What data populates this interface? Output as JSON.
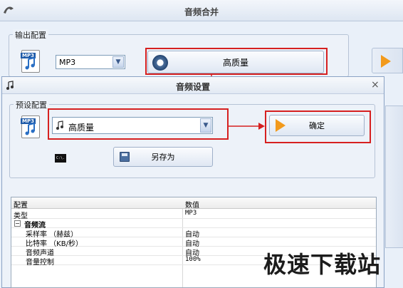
{
  "main": {
    "title": "音频合并",
    "output_group_label": "输出配置",
    "format_value": "MP3",
    "quality_button_label": "高质量"
  },
  "dialog": {
    "title": "音频设置",
    "close_glyph": "×",
    "preset_group_label": "预设配置",
    "preset_value": "高质量",
    "confirm_label": "确定",
    "save_as_label": "另存为",
    "cmd_glyph": "C:\\."
  },
  "icons": {
    "file_tag": "MP3"
  },
  "grid": {
    "headers": [
      "配置",
      "数值"
    ],
    "rows": [
      {
        "name": "类型",
        "value": "MP3"
      },
      {
        "name": "音频流",
        "value": ""
      },
      {
        "name": "采样率 （赫兹）",
        "value": "自动"
      },
      {
        "name": "比特率 （KB/秒）",
        "value": "自动"
      },
      {
        "name": "音频声道",
        "value": "自动"
      },
      {
        "name": "音量控制",
        "value": "100%"
      }
    ]
  },
  "watermark": "极速下载站",
  "colors": {
    "highlight_red": "#d62020",
    "accent_orange": "#f29a1c"
  }
}
